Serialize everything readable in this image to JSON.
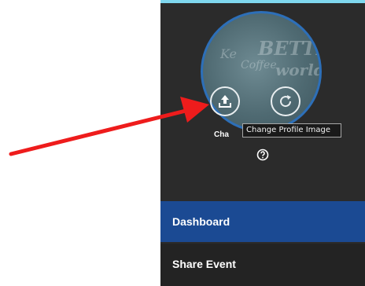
{
  "profile": {
    "avatar_text": [
      "Ke",
      "BETTER",
      "Coffee",
      "world"
    ],
    "upload_label": "Cha",
    "tooltip": "Change Profile Image"
  },
  "nav": {
    "items": [
      {
        "label": "Dashboard",
        "active": true
      },
      {
        "label": "Share Event",
        "active": false
      }
    ]
  },
  "colors": {
    "panel_bg": "#2b2b2b",
    "active_nav": "#1b4a93",
    "avatar_border": "#2d6fb8",
    "annotation_arrow": "#ee1c1c"
  },
  "icons": {
    "upload": "upload-icon",
    "reset": "refresh-icon",
    "help": "help-icon"
  }
}
